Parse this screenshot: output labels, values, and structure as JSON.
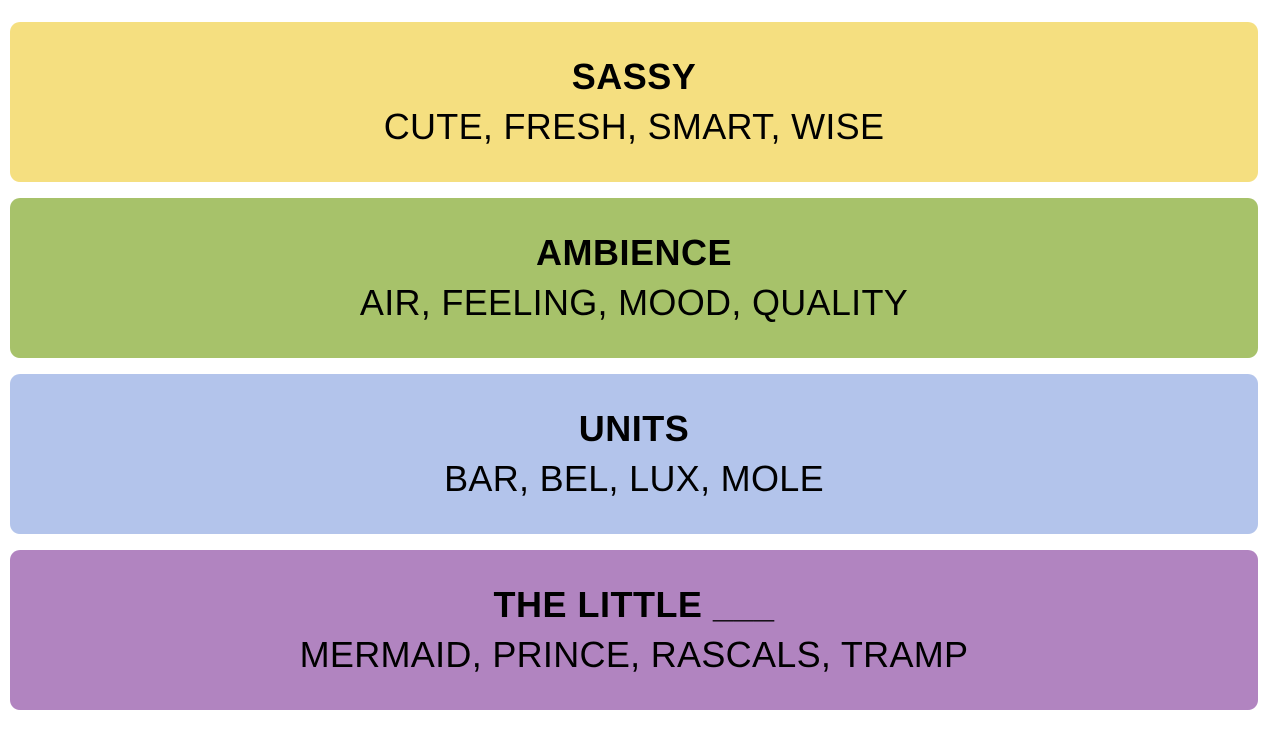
{
  "groups": [
    {
      "title": "SASSY",
      "members": "CUTE, FRESH, SMART, WISE",
      "color": "#f5df80"
    },
    {
      "title": "AMBIENCE",
      "members": "AIR, FEELING, MOOD, QUALITY",
      "color": "#a7c26a"
    },
    {
      "title": "UNITS",
      "members": "BAR, BEL, LUX, MOLE",
      "color": "#b3c4eb"
    },
    {
      "title": "THE LITTLE ___",
      "members": "MERMAID, PRINCE, RASCALS, TRAMP",
      "color": "#b184c0"
    }
  ]
}
